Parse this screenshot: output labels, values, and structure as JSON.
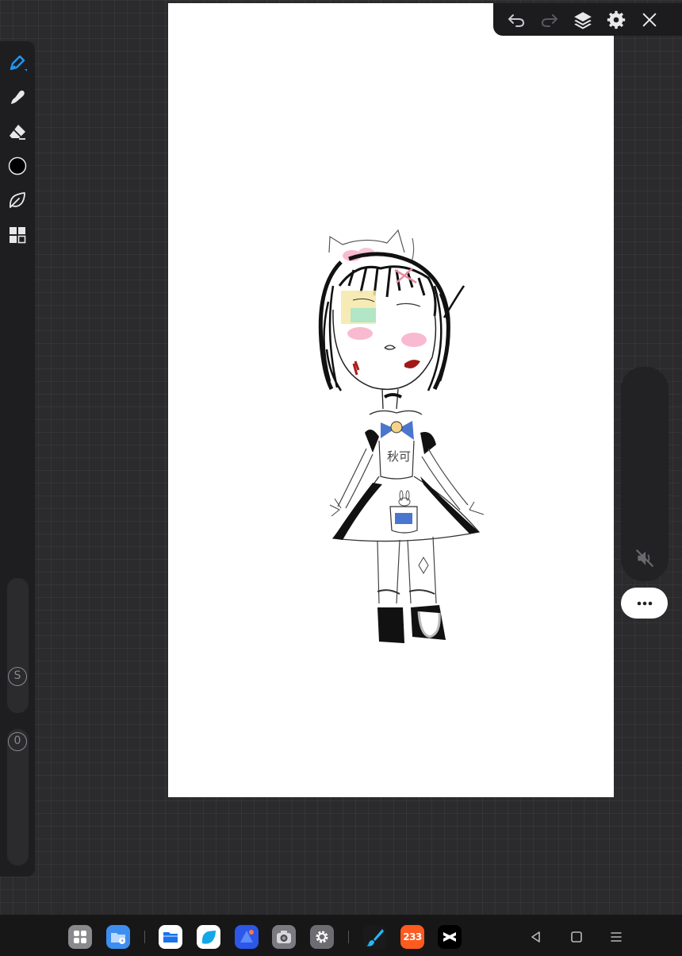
{
  "colors": {
    "workspace": "#2b2b2d",
    "toolbar": "#1c1c1e",
    "accent": "#2196f3",
    "canvas": "#ffffff"
  },
  "toolbar": {
    "icons": [
      "undo-icon",
      "redo-icon",
      "layers-icon",
      "gear-icon",
      "close-icon"
    ]
  },
  "tools": {
    "icons": [
      "pen-icon",
      "smudge-icon",
      "eraser-icon",
      "color-swatch",
      "leaf-icon",
      "grid-icon"
    ],
    "active": "pen-icon",
    "current_color": "#000000"
  },
  "sliders": {
    "size_label": "S",
    "opacity_label": "0"
  },
  "drawing": {
    "badge_text": "秋可"
  },
  "right_panel": {
    "icons": [
      "mute-icon",
      "more-icon"
    ]
  },
  "taskbar": {
    "apps": [
      "app-drawer-icon",
      "file-manager-icon",
      "files-icon",
      "notes-icon",
      "browser-icon",
      "camera-icon",
      "settings-icon",
      "paint-app-icon",
      "233-app-icon",
      "capcut-icon"
    ],
    "badge_233": "233",
    "nav": [
      "back-icon",
      "home-icon",
      "menu-icon"
    ]
  }
}
